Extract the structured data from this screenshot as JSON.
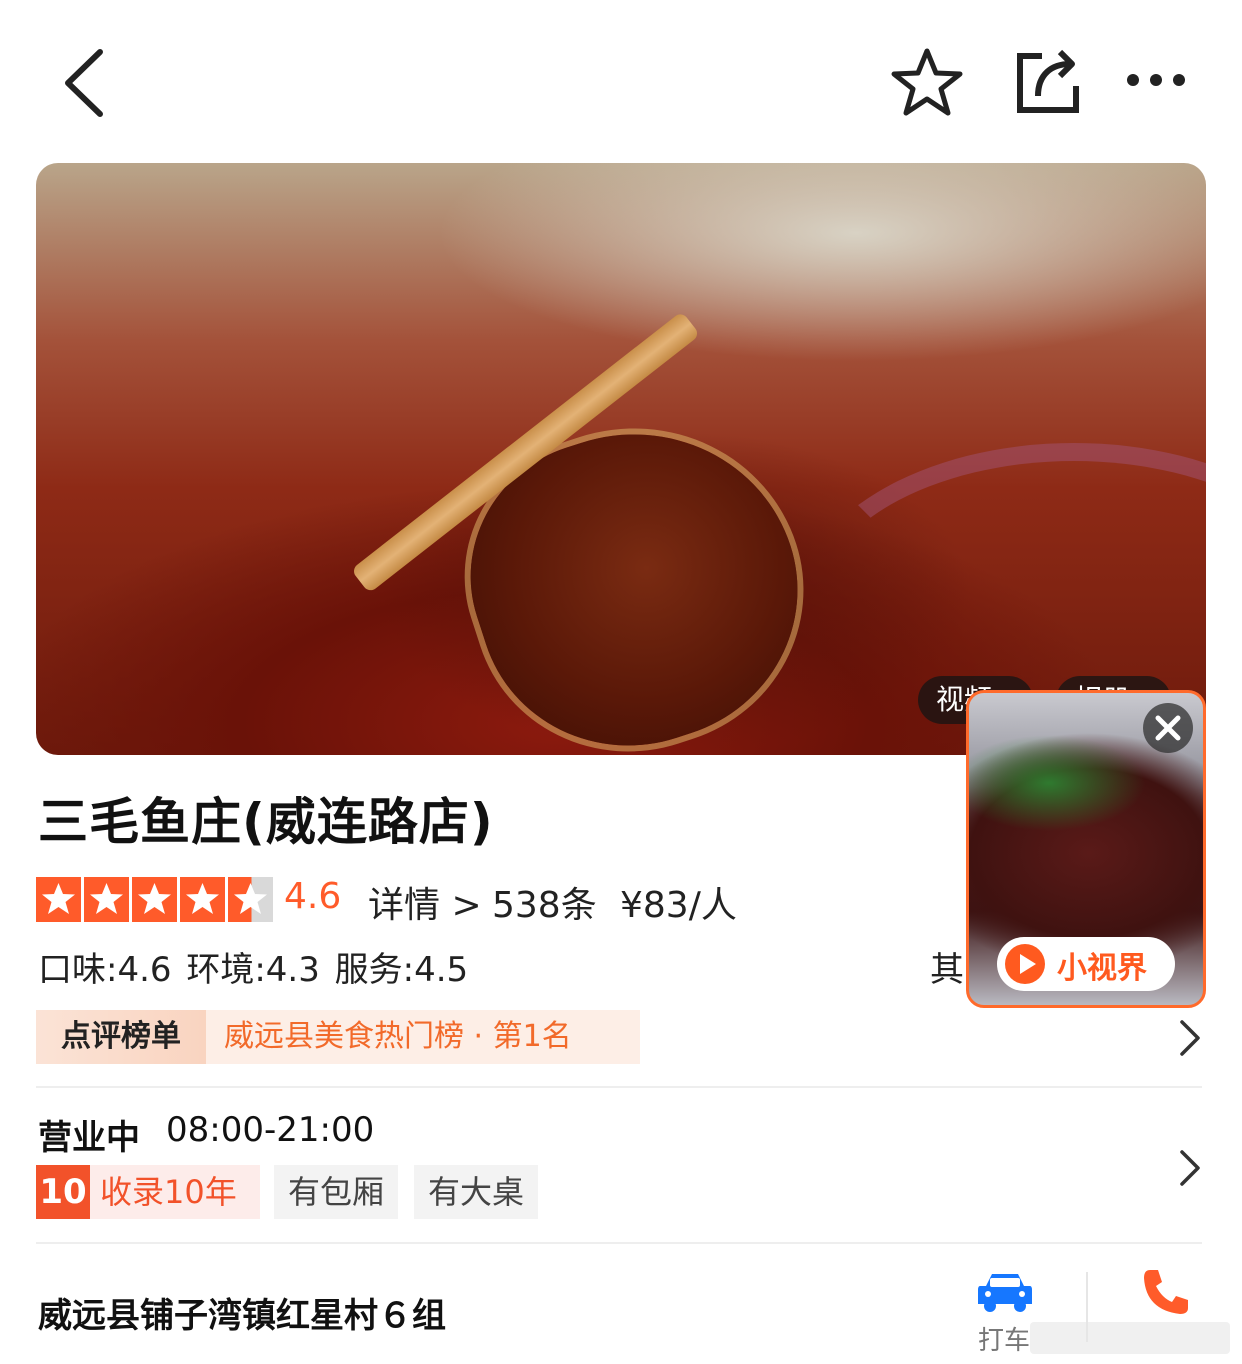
{
  "colors": {
    "accent": "#ff5b2a",
    "rank_text": "#f26a2a",
    "years_tag": "#f2522a",
    "taxi_icon": "#1677ff",
    "phone_icon": "#ff5b2a"
  },
  "topbar": {
    "icons": [
      "back-icon",
      "star-icon",
      "share-icon",
      "more-icon"
    ]
  },
  "hero": {
    "video_tab": "视频>",
    "photo_tab": "相册>"
  },
  "mini_video": {
    "badge_text": "小视界"
  },
  "shop": {
    "name": "三毛鱼庄(威连路店)",
    "stars": 4.6,
    "rating": "4.6",
    "detail_link": "详情 >",
    "reviews": "538条",
    "price": "¥83/人",
    "subscores": "口味:4.6  环境:4.3  服务:4.5",
    "other": "其"
  },
  "rank": {
    "label": "点评榜单",
    "text": "威远县美食热门榜 · 第1名"
  },
  "hours": {
    "status": "营业中",
    "time": "08:00-21:00"
  },
  "tags": {
    "years_num": "10",
    "years_text": "收录10年",
    "room": "有包厢",
    "big_table": "有大桌"
  },
  "address": {
    "text": "威远县铺子湾镇红星村６组",
    "taxi_label": "打车"
  }
}
